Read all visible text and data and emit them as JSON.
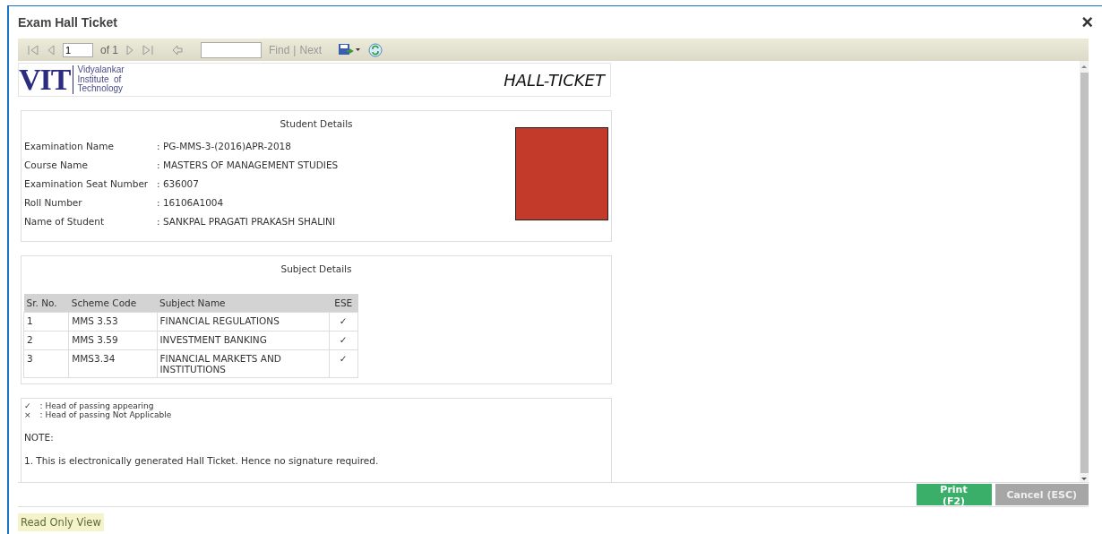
{
  "window": {
    "title": "Exam Hall Ticket",
    "close": "×"
  },
  "toolbar": {
    "page": "1",
    "of": "of 1",
    "find_label": "Find",
    "separator": "|",
    "next_label": "Next"
  },
  "report": {
    "logo": {
      "letters": "VIT",
      "lines": [
        "Vidyalankar",
        "Institute  of",
        "Technology"
      ]
    },
    "heading": "HALL-TICKET",
    "student": {
      "title": "Student Details",
      "fields": [
        {
          "label": "Examination Name",
          "value": ": PG-MMS-3-(2016)APR-2018"
        },
        {
          "label": "Course Name",
          "value": ": MASTERS OF MANAGEMENT STUDIES"
        },
        {
          "label": "Examination Seat Number",
          "value": ": 636007"
        },
        {
          "label": "Roll Number",
          "value": ": 16106A1004"
        },
        {
          "label": "Name of Student",
          "value": ": SANKPAL PRAGATI PRAKASH SHALINI"
        }
      ]
    },
    "subjects": {
      "title": "Subject Details",
      "columns": [
        "Sr. No.",
        "Scheme Code",
        "Subject Name",
        "ESE"
      ],
      "rows": [
        [
          "1",
          "MMS 3.53",
          "FINANCIAL REGULATIONS",
          "✓"
        ],
        [
          "2",
          "MMS 3.59",
          "INVESTMENT BANKING",
          "✓"
        ],
        [
          "3",
          "MMS3.34",
          "FINANCIAL MARKETS AND INSTITUTIONS",
          "✓"
        ]
      ]
    },
    "legend": [
      {
        "symbol": "✓",
        "text": ": Head of passing appearing"
      },
      {
        "symbol": "×",
        "text": ": Head of passing Not Applicable"
      }
    ],
    "note_title": "NOTE:",
    "notes": [
      "1. This is electronically generated Hall Ticket. Hence no signature required."
    ]
  },
  "buttons": [
    {
      "label": "Print (F2)",
      "kind": "primary"
    },
    {
      "label": "Cancel (ESC)",
      "kind": "secondary"
    }
  ],
  "status": "Read Only View"
}
